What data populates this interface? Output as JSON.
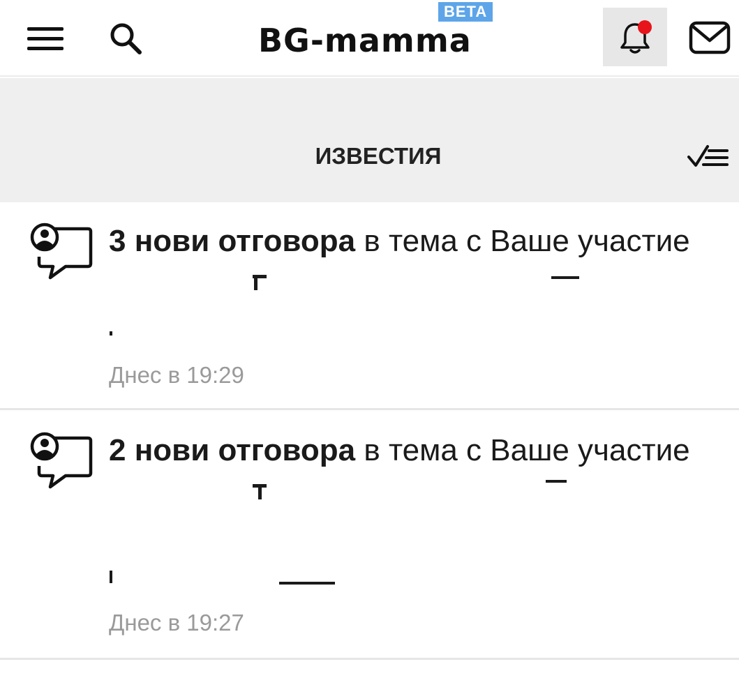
{
  "header": {
    "logo_text": "BG-mamma",
    "beta_label": "BETA",
    "icons": {
      "menu": "hamburger-menu-icon",
      "search": "search-icon",
      "notifications": "bell-icon",
      "messages": "envelope-icon"
    },
    "has_unread_dot": true
  },
  "section": {
    "title": "ИЗВЕСТИЯ",
    "mark_all_icon": "check-list-icon"
  },
  "notifications": [
    {
      "count_text": "3 нови отговора",
      "rest_text": " в тема с Ваше участие ",
      "topic": "",
      "time": "Днес в 19:29"
    },
    {
      "count_text": "2 нови отговора",
      "rest_text": " в тема с Ваше участие ",
      "topic": "",
      "time": "Днес в 19:27"
    }
  ],
  "colors": {
    "beta_badge": "#5da5e8",
    "unread_dot": "#e8141b",
    "section_bg": "#efefef",
    "time_text": "#9a9a9a"
  }
}
